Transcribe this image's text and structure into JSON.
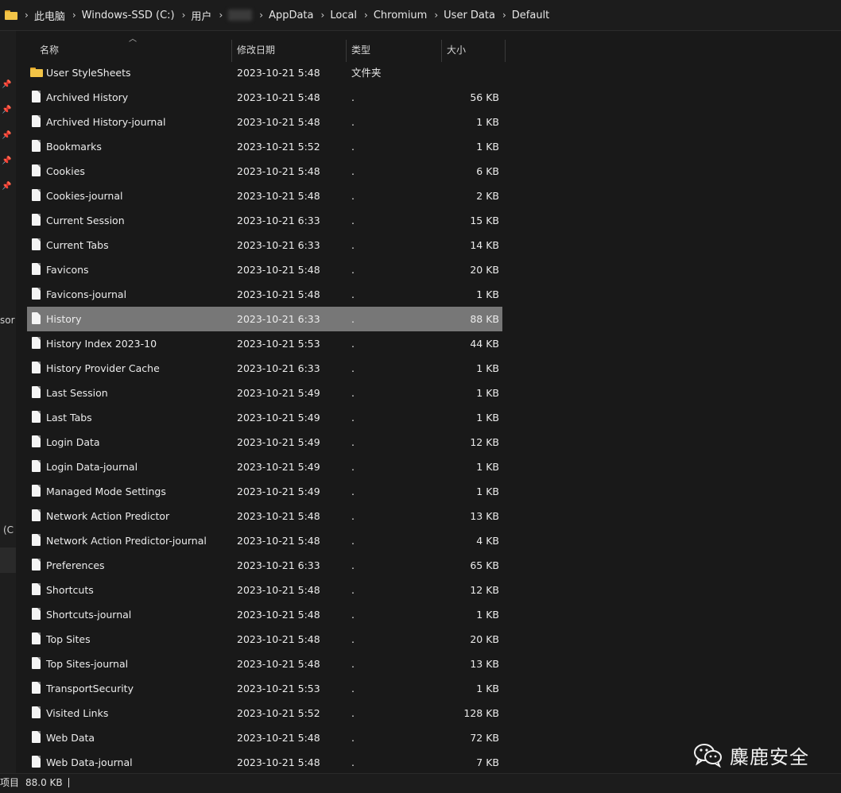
{
  "breadcrumb": [
    "此电脑",
    "Windows-SSD (C:)",
    "用户",
    "AppData",
    "Local",
    "Chromium",
    "User Data",
    "Default"
  ],
  "left_pane": {
    "partial_text_1": "sor",
    "partial_text_2": "(C"
  },
  "columns": {
    "name": "名称",
    "date": "修改日期",
    "type": "类型",
    "size": "大小"
  },
  "files": [
    {
      "name": "User StyleSheets",
      "date": "2023-10-21 5:48",
      "type": "文件夹",
      "size": "",
      "is_folder": true
    },
    {
      "name": "Archived History",
      "date": "2023-10-21 5:48",
      "type": ".",
      "size": "56 KB"
    },
    {
      "name": "Archived History-journal",
      "date": "2023-10-21 5:48",
      "type": ".",
      "size": "1 KB"
    },
    {
      "name": "Bookmarks",
      "date": "2023-10-21 5:52",
      "type": ".",
      "size": "1 KB"
    },
    {
      "name": "Cookies",
      "date": "2023-10-21 5:48",
      "type": ".",
      "size": "6 KB"
    },
    {
      "name": "Cookies-journal",
      "date": "2023-10-21 5:48",
      "type": ".",
      "size": "2 KB"
    },
    {
      "name": "Current Session",
      "date": "2023-10-21 6:33",
      "type": ".",
      "size": "15 KB"
    },
    {
      "name": "Current Tabs",
      "date": "2023-10-21 6:33",
      "type": ".",
      "size": "14 KB"
    },
    {
      "name": "Favicons",
      "date": "2023-10-21 5:48",
      "type": ".",
      "size": "20 KB"
    },
    {
      "name": "Favicons-journal",
      "date": "2023-10-21 5:48",
      "type": ".",
      "size": "1 KB"
    },
    {
      "name": "History",
      "date": "2023-10-21 6:33",
      "type": ".",
      "size": "88 KB",
      "selected": true
    },
    {
      "name": "History Index 2023-10",
      "date": "2023-10-21 5:53",
      "type": ".",
      "size": "44 KB"
    },
    {
      "name": "History Provider Cache",
      "date": "2023-10-21 6:33",
      "type": ".",
      "size": "1 KB"
    },
    {
      "name": "Last Session",
      "date": "2023-10-21 5:49",
      "type": ".",
      "size": "1 KB"
    },
    {
      "name": "Last Tabs",
      "date": "2023-10-21 5:49",
      "type": ".",
      "size": "1 KB"
    },
    {
      "name": "Login Data",
      "date": "2023-10-21 5:49",
      "type": ".",
      "size": "12 KB"
    },
    {
      "name": "Login Data-journal",
      "date": "2023-10-21 5:49",
      "type": ".",
      "size": "1 KB"
    },
    {
      "name": "Managed Mode Settings",
      "date": "2023-10-21 5:49",
      "type": ".",
      "size": "1 KB"
    },
    {
      "name": "Network Action Predictor",
      "date": "2023-10-21 5:48",
      "type": ".",
      "size": "13 KB"
    },
    {
      "name": "Network Action Predictor-journal",
      "date": "2023-10-21 5:48",
      "type": ".",
      "size": "4 KB"
    },
    {
      "name": "Preferences",
      "date": "2023-10-21 6:33",
      "type": ".",
      "size": "65 KB"
    },
    {
      "name": "Shortcuts",
      "date": "2023-10-21 5:48",
      "type": ".",
      "size": "12 KB"
    },
    {
      "name": "Shortcuts-journal",
      "date": "2023-10-21 5:48",
      "type": ".",
      "size": "1 KB"
    },
    {
      "name": "Top Sites",
      "date": "2023-10-21 5:48",
      "type": ".",
      "size": "20 KB"
    },
    {
      "name": "Top Sites-journal",
      "date": "2023-10-21 5:48",
      "type": ".",
      "size": "13 KB"
    },
    {
      "name": "TransportSecurity",
      "date": "2023-10-21 5:53",
      "type": ".",
      "size": "1 KB"
    },
    {
      "name": "Visited Links",
      "date": "2023-10-21 5:52",
      "type": ".",
      "size": "128 KB"
    },
    {
      "name": "Web Data",
      "date": "2023-10-21 5:48",
      "type": ".",
      "size": "72 KB"
    },
    {
      "name": "Web Data-journal",
      "date": "2023-10-21 5:48",
      "type": ".",
      "size": "7 KB"
    }
  ],
  "status": {
    "items_label": "项目",
    "selection_size": "88.0 KB"
  },
  "watermark": {
    "text": "麋鹿安全",
    "icon": "wechat-icon"
  },
  "colors": {
    "background": "#191919",
    "selected_row": "#777777",
    "folder": "#f2c447"
  }
}
